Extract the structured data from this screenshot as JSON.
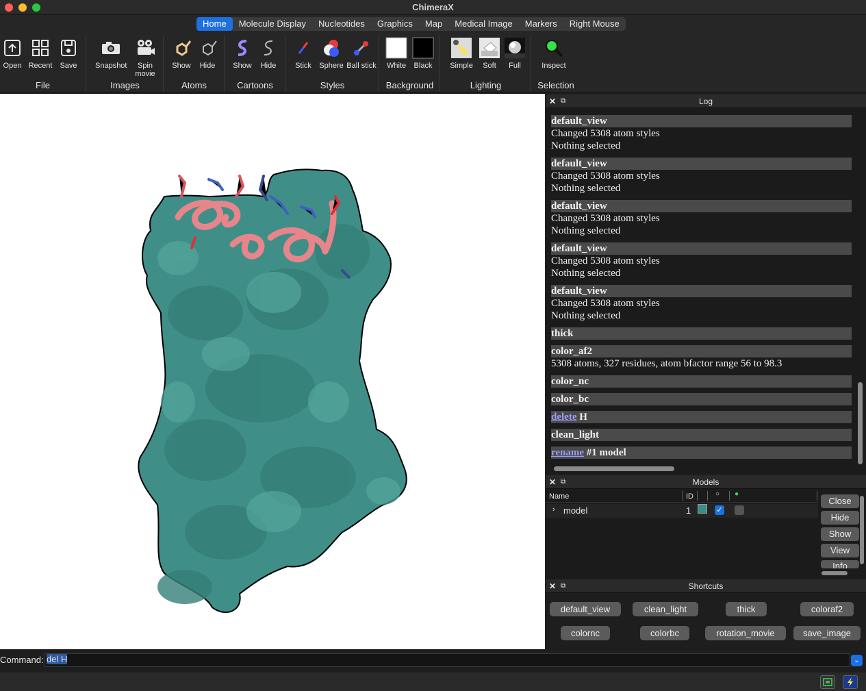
{
  "app": {
    "title": "ChimeraX"
  },
  "tabs": [
    "Home",
    "Molecule Display",
    "Nucleotides",
    "Graphics",
    "Map",
    "Medical Image",
    "Markers",
    "Right Mouse"
  ],
  "toolbar": {
    "groups": {
      "file": {
        "label": "File",
        "tools": [
          "Open",
          "Recent",
          "Save"
        ]
      },
      "images": {
        "label": "Images",
        "tools": [
          "Snapshot",
          "Spin movie"
        ]
      },
      "atoms": {
        "label": "Atoms",
        "tools": [
          "Show",
          "Hide"
        ]
      },
      "cartoons": {
        "label": "Cartoons",
        "tools": [
          "Show",
          "Hide"
        ]
      },
      "styles": {
        "label": "Styles",
        "tools": [
          "Stick",
          "Sphere",
          "Ball stick"
        ]
      },
      "background": {
        "label": "Background",
        "tools": [
          "White",
          "Black"
        ]
      },
      "lighting": {
        "label": "Lighting",
        "tools": [
          "Simple",
          "Soft",
          "Full"
        ]
      },
      "selection": {
        "label": "Selection",
        "tools": [
          "Inspect"
        ]
      }
    }
  },
  "log": {
    "title": "Log",
    "entries": [
      {
        "cmd": "default_view",
        "lines": [
          "Changed 5308 atom styles",
          "Nothing selected"
        ]
      },
      {
        "cmd": "default_view",
        "lines": [
          "Changed 5308 atom styles",
          "Nothing selected"
        ]
      },
      {
        "cmd": "default_view",
        "lines": [
          "Changed 5308 atom styles",
          "Nothing selected"
        ]
      },
      {
        "cmd": "default_view",
        "lines": [
          "Changed 5308 atom styles",
          "Nothing selected"
        ]
      },
      {
        "cmd": "default_view",
        "lines": [
          "Changed 5308 atom styles",
          "Nothing selected"
        ]
      },
      {
        "cmd": "thick",
        "lines": []
      },
      {
        "cmd": "color_af2",
        "lines": [
          "5308 atoms, 327 residues, atom bfactor range 56 to 98.3"
        ]
      },
      {
        "cmd": "color_nc",
        "lines": []
      },
      {
        "cmd": "color_bc",
        "lines": []
      },
      {
        "cmd_link": "delete",
        "cmd_rest": " H",
        "lines": []
      },
      {
        "cmd": "clean_light",
        "lines": []
      },
      {
        "cmd_link": "rename",
        "cmd_rest": " #1 model",
        "lines": []
      }
    ]
  },
  "models": {
    "title": "Models",
    "columns": {
      "name": "Name",
      "id": "ID"
    },
    "rows": [
      {
        "name": "model",
        "id": "1",
        "color": "#3a8c86",
        "shown": true
      }
    ],
    "buttons": [
      "Close",
      "Hide",
      "Show",
      "View",
      "Info"
    ]
  },
  "shortcuts": {
    "title": "Shortcuts",
    "buttons": [
      "default_view",
      "clean_light",
      "thick",
      "coloraf2",
      "colornc",
      "colorbc",
      "rotation_movie",
      "save_image"
    ]
  },
  "command": {
    "label": "Command:",
    "value": "del H"
  },
  "colors": {
    "accent": "#1e6fe0",
    "surface": "#3f8f88",
    "helix": "#e8858a"
  }
}
